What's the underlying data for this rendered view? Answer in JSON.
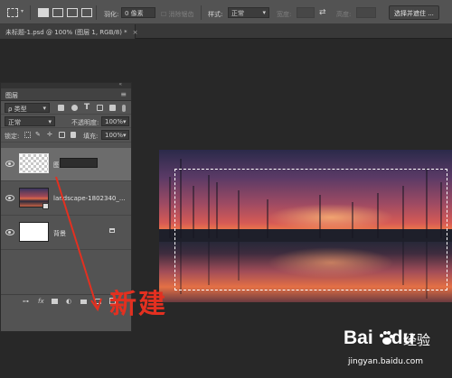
{
  "options_bar": {
    "feather_label": "羽化:",
    "feather_value": "0 像素",
    "antialias_label": "消除锯齿",
    "style_label": "样式:",
    "style_value": "正常",
    "width_label": "宽度:",
    "height_label": "高度:",
    "select_mask_button": "选择并遮住 ..."
  },
  "doc_tab": {
    "title": "未标题-1.psd @ 100% (图层 1, RGB/8) *",
    "close": "×"
  },
  "layers_panel": {
    "title": "图层",
    "filter_kind": "ρ 类型",
    "blend_mode": "正常",
    "opacity_label": "不透明度:",
    "opacity_value": "100%",
    "lock_label": "锁定:",
    "fill_label": "填充:",
    "fill_value": "100%",
    "layers": [
      {
        "name": "图层 1",
        "thumbnail": "transparent",
        "visible": true,
        "editing": true
      },
      {
        "name": "landscape-1802340_...",
        "thumbnail": "photo",
        "visible": true,
        "smart_object": true
      },
      {
        "name": "背景",
        "thumbnail": "white",
        "visible": true,
        "locked": true
      }
    ],
    "footer_icons": [
      "link-icon",
      "fx-icon",
      "mask-icon",
      "adjustment-icon",
      "folder-icon",
      "new-layer-icon",
      "trash-icon"
    ],
    "fx_label": "fx"
  },
  "annotation": {
    "text": "新建",
    "color": "#e33020"
  },
  "watermark": {
    "logo": "Bai",
    "logo_tail": "du",
    "cn": "经验",
    "url": "jingyan.baidu.com"
  },
  "colors": {
    "panel": "#535353",
    "workspace": "#282828",
    "annotation": "#e33020"
  }
}
